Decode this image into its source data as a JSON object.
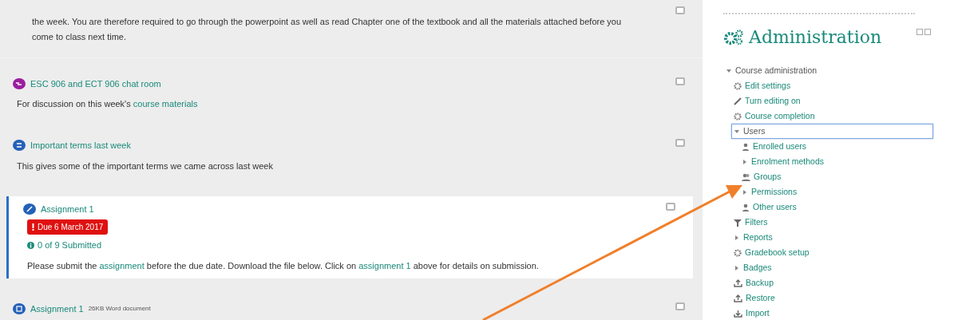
{
  "intro": {
    "text": "the week. You are therefore required to go through the powerpoint as well as read Chapter one of the textbook and all the materials attached  before you come to class next time.",
    "completed": false
  },
  "activities": [
    {
      "kind": "chat",
      "title": "ESC 906 and ECT 906 chat room",
      "description": [
        {
          "text": "For discussion on this week's",
          "link": false
        },
        {
          "text": "course materials",
          "link": true
        }
      ],
      "highlighted": false,
      "completed": false
    },
    {
      "kind": "page",
      "title": "Important terms last week",
      "description": [
        {
          "text": "This gives some of the important terms we came across last week",
          "link": false
        }
      ],
      "highlighted": false,
      "completed": false
    },
    {
      "kind": "assignment",
      "title": "Assignment 1",
      "due": "Due 6 March 2017",
      "submitted": "0 of 9 Submitted",
      "description": [
        {
          "text": "Please submit the",
          "link": false
        },
        {
          "text": "assignment",
          "link": true
        },
        {
          "text": "before the due date. Download the file below. Click on",
          "link": false
        },
        {
          "text": "assignment 1",
          "link": true
        },
        {
          "text": "above for details on submission.",
          "link": false
        }
      ],
      "highlighted": true,
      "completed": false
    },
    {
      "kind": "file",
      "title": "Assignment 1",
      "details": "26KB Word document",
      "highlighted": false,
      "completed": false
    }
  ],
  "administration": {
    "title": "Administration",
    "tree": [
      {
        "kind": "caret",
        "label": "Course administration",
        "expanded": true,
        "selected": false,
        "children": [
          {
            "kind": "gear",
            "label": "Edit settings",
            "selected": false
          },
          {
            "kind": "pencil",
            "label": "Turn editing on",
            "selected": false
          },
          {
            "kind": "gear",
            "label": "Course completion",
            "selected": false
          },
          {
            "kind": "caret",
            "label": "Users",
            "expanded": true,
            "selected": true,
            "children": [
              {
                "kind": "user",
                "label": "Enrolled users",
                "selected": false
              },
              {
                "kind": "caret",
                "label": "Enrolment methods",
                "expanded": false,
                "selected": false
              },
              {
                "kind": "group",
                "label": "Groups",
                "selected": false
              },
              {
                "kind": "caret",
                "label": "Permissions",
                "expanded": false,
                "selected": false
              },
              {
                "kind": "user",
                "label": "Other users",
                "selected": false
              }
            ]
          },
          {
            "kind": "filter",
            "label": "Filters",
            "selected": false
          },
          {
            "kind": "caret",
            "label": "Reports",
            "expanded": false,
            "selected": false
          },
          {
            "kind": "gear",
            "label": "Gradebook setup",
            "selected": false
          },
          {
            "kind": "caret",
            "label": "Badges",
            "expanded": false,
            "selected": false
          },
          {
            "kind": "upload",
            "label": "Backup",
            "selected": false
          },
          {
            "kind": "upload",
            "label": "Restore",
            "selected": false
          },
          {
            "kind": "download",
            "label": "Import",
            "selected": false
          }
        ]
      }
    ]
  }
}
